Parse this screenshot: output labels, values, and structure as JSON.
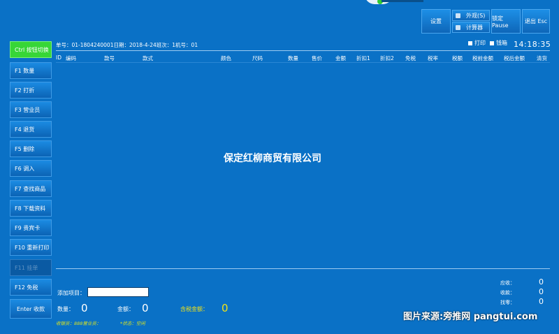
{
  "toolbar": {
    "settings": "设置",
    "appearance": "外观(S)",
    "calculator": "计算器",
    "lock": "锁定 Pause",
    "exit": "退出 Esc"
  },
  "sidebar": [
    {
      "label": "Ctrl 按钮切换",
      "state": "active"
    },
    {
      "label": "F1 数量"
    },
    {
      "label": "F2 打折"
    },
    {
      "label": "F3 营业员"
    },
    {
      "label": "F4 退货"
    },
    {
      "label": "F5 删除"
    },
    {
      "label": "F6 调入"
    },
    {
      "label": "F7 查找商品"
    },
    {
      "label": "F8 下载资料"
    },
    {
      "label": "F9 贵宾卡"
    },
    {
      "label": "F10 重新打印"
    },
    {
      "label": "F11 挂单",
      "state": "disabled"
    },
    {
      "label": "F12 免税"
    },
    {
      "label": "Enter 收款"
    }
  ],
  "info": {
    "order_line": "单号：01-1804240001日期：2018-4-24班次：1机号：01",
    "print": "打印",
    "cash_drawer": "钱箱",
    "time": "14:18:35"
  },
  "columns": [
    "ID",
    "编码",
    "款号",
    "款式",
    "颜色",
    "尺码",
    "数量",
    "售价",
    "金额",
    "折扣1",
    "折扣2",
    "免税",
    "税率",
    "税额",
    "税前金额",
    "税后金额",
    "清货"
  ],
  "watermark": "保定红柳商贸有限公司",
  "bottom": {
    "add_item": "添加项目：",
    "qty_label": "数量：",
    "qty_value": "0",
    "amount_label": "金额：",
    "amount_value": "0",
    "tax_amount_label": "含税金额：",
    "tax_amount_value": "0",
    "cashier": "收银员：888营业员：",
    "status": "*状态：空闲"
  },
  "summary": {
    "receivable_label": "应收：",
    "receivable_value": "0",
    "received_label": "收款：",
    "received_value": "0",
    "change_label": "找零：",
    "change_value": "0"
  },
  "credit": "图片来源:旁推网 pangtui.com",
  "colors": {
    "background": "#0a71c6",
    "active_button": "#37d637",
    "highlight_text": "#f2e317"
  }
}
